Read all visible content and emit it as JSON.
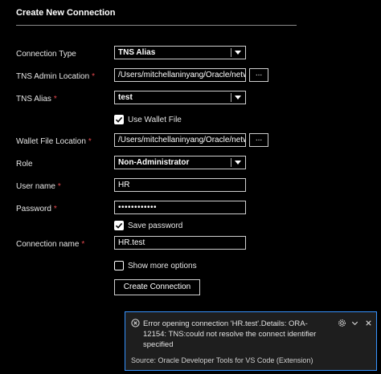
{
  "dialog": {
    "title": "Create New Connection"
  },
  "form": {
    "connection_type": {
      "label": "Connection Type",
      "value": "TNS Alias"
    },
    "tns_admin_location": {
      "label": "TNS Admin Location",
      "value": "/Users/mitchellaninyang/Oracle/netw",
      "browse": "..."
    },
    "tns_alias": {
      "label": "TNS Alias",
      "value": "test"
    },
    "use_wallet_file": {
      "label": "Use Wallet File",
      "checked": true
    },
    "wallet_file_location": {
      "label": "Wallet File Location",
      "value": "/Users/mitchellaninyang/Oracle/netw",
      "browse": "..."
    },
    "role": {
      "label": "Role",
      "value": "Non-Administrator"
    },
    "user_name": {
      "label": "User name",
      "value": "HR"
    },
    "password": {
      "label": "Password",
      "value": "••••••••••••"
    },
    "save_password": {
      "label": "Save password",
      "checked": true
    },
    "connection_name": {
      "label": "Connection name",
      "value": "HR.test"
    },
    "show_more_options": {
      "label": "Show more options",
      "checked": false
    },
    "required_marker": "*",
    "submit_label": "Create Connection"
  },
  "notification": {
    "message": "Error opening connection 'HR.test'.Details: ORA-12154: TNS:could not resolve the connect identifier specified",
    "source": "Source: Oracle Developer Tools for VS Code (Extension)",
    "icons": [
      "error-icon",
      "gear-icon",
      "chevron-down-icon",
      "close-icon"
    ],
    "border_color": "#3794ff"
  },
  "colors": {
    "background": "#000000",
    "required": "#e5484d",
    "text": "#e6e6e6"
  }
}
